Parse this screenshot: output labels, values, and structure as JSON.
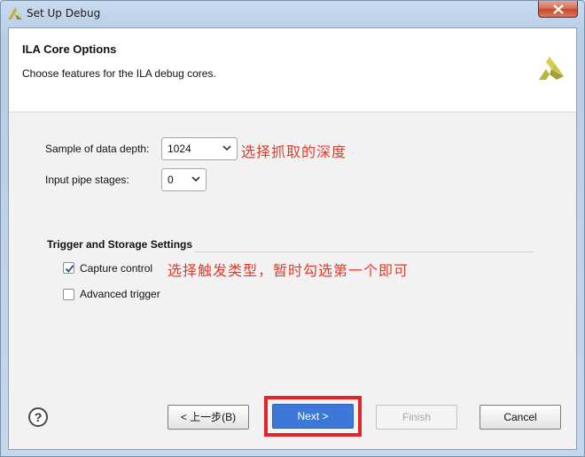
{
  "window": {
    "title": "Set Up Debug"
  },
  "header": {
    "title": "ILA Core Options",
    "subtitle": "Choose features for the ILA debug cores."
  },
  "fields": {
    "data_depth_label": "Sample of data depth:",
    "data_depth_value": "1024",
    "pipe_stages_label": "Input pipe stages:",
    "pipe_stages_value": "0"
  },
  "section": {
    "title": "Trigger and Storage Settings",
    "capture_control_label": "Capture control",
    "capture_control_checked": true,
    "advanced_trigger_label": "Advanced trigger",
    "advanced_trigger_checked": false
  },
  "annotations": {
    "depth_note": "选择抓取的深度",
    "trigger_note": "选择触发类型，暂时勾选第一个即可"
  },
  "footer": {
    "help_label": "?",
    "back_label": "< 上一步(B)",
    "next_label": "Next >",
    "finish_label": "Finish",
    "cancel_label": "Cancel"
  },
  "colors": {
    "annotation": "#e23a2c",
    "highlight_box": "#e0262b",
    "primary_button": "#3b78d8",
    "logo": "#b5b53a"
  }
}
